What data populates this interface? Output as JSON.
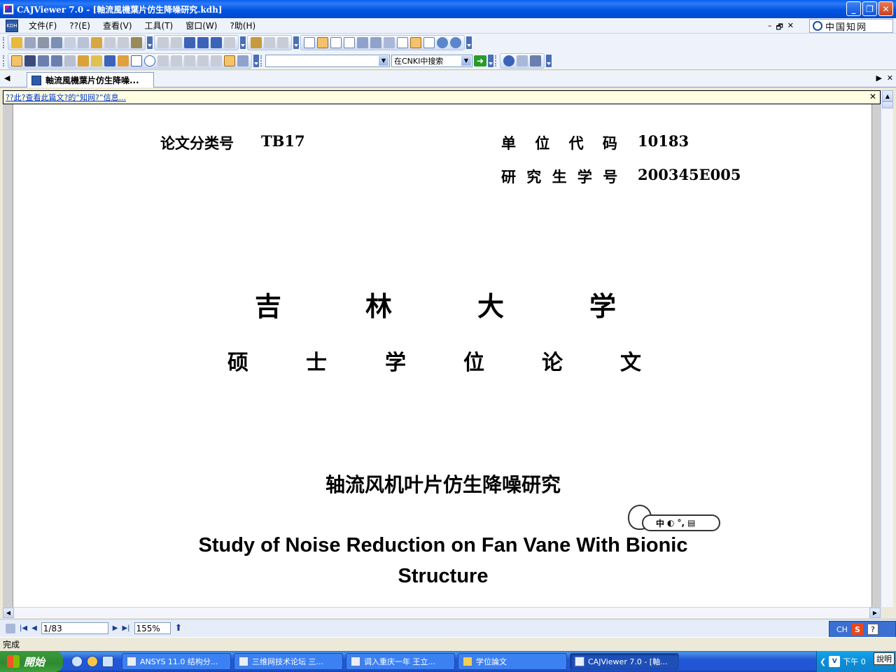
{
  "window": {
    "title": "CAJViewer 7.0 - [軸流風機葉片仿生降噪研究.kdh]",
    "minimize": "_",
    "maximize": "❐",
    "close": "✕"
  },
  "menu": {
    "kdh_icon": "KDH",
    "items": [
      "文件(F)",
      "??(E)",
      "查看(V)",
      "工具(T)",
      "窗口(W)",
      "?助(H)"
    ],
    "mdi_min": "–",
    "mdi_restore": "🗗",
    "mdi_close": "✕",
    "cnki_label": "中国知网"
  },
  "toolbar": {
    "search_text": "",
    "search_scope": "在CNKI中搜索"
  },
  "tabs": [
    {
      "label": "軸流風機葉片仿生降噪..."
    }
  ],
  "infobar": {
    "link_text": "??此?查看此篇文?的“知网?”信息...",
    "close": "✕"
  },
  "document": {
    "class_no_label": "论文分类号",
    "class_no_value": "TB17",
    "unit_code_label": "单 位 代 码",
    "unit_code_value": "10183",
    "student_no_label": "研 究 生 学 号",
    "student_no_value": "200345E005",
    "university_chars": [
      "吉",
      "林",
      "大",
      "学"
    ],
    "degree_chars": [
      "硕",
      "士",
      "学",
      "位",
      "论",
      "文"
    ],
    "title_cn": "轴流风机叶片仿生降噪研究",
    "title_en_line1": "Study of Noise Reduction on Fan Vane With Bionic",
    "title_en_line2": "Structure",
    "ime_text": "中"
  },
  "pagebar": {
    "page_value": "1/83",
    "zoom_value": "155%",
    "lang": "CH",
    "sogou": "S",
    "help": "?"
  },
  "status": {
    "text": "完成"
  },
  "taskbar": {
    "start_label": "開始",
    "tasks": [
      {
        "label": "ANSYS 11.0 结构分..."
      },
      {
        "label": "三维网技术论坛 三..."
      },
      {
        "label": "调入重庆一年 王立..."
      },
      {
        "label": "学位論文"
      },
      {
        "label": "CAJViewer 7.0 - [軸..."
      }
    ],
    "tray_clock": "下午 0",
    "tray_help": "說明",
    "tray_v": "V"
  },
  "colors": {
    "titlebar": "#0054E3",
    "infobar_bg": "#FFFFE1",
    "link": "#0033CC",
    "taskbar": "#2157D7",
    "start_green": "#2F8A2F"
  }
}
